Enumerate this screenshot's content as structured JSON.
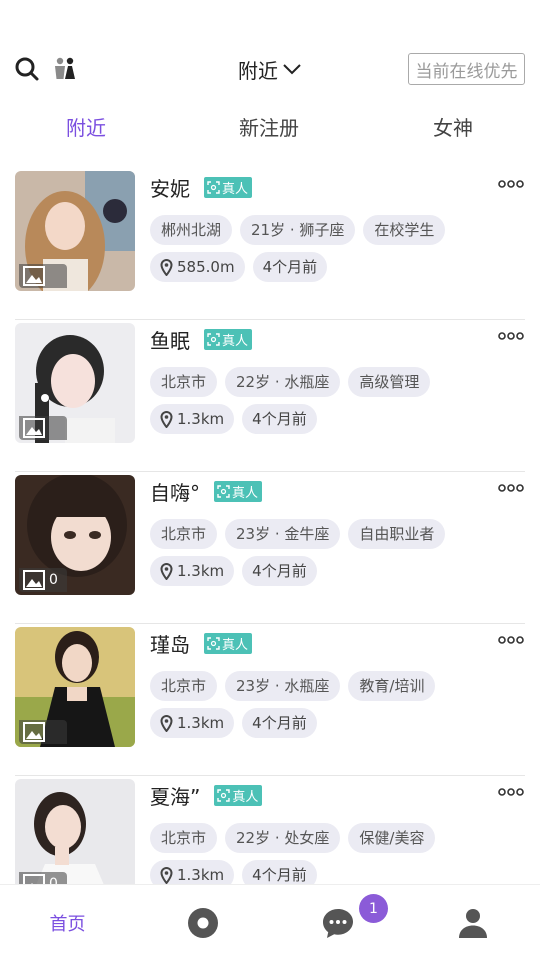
{
  "header": {
    "location_label": "附近",
    "online_button": "当前在线优先"
  },
  "tabs": [
    {
      "label": "附近",
      "active": true
    },
    {
      "label": "新注册",
      "active": false
    },
    {
      "label": "女神",
      "active": false
    }
  ],
  "verified_label": "真人",
  "users": [
    {
      "name": "安妮",
      "city": "郴州北湖",
      "age_sign": "21岁 · 狮子座",
      "occupation": "在校学生",
      "distance": "585.0m",
      "last_active": "4个月前",
      "photo_count": ""
    },
    {
      "name": "鱼眠",
      "city": "北京市",
      "age_sign": "22岁 · 水瓶座",
      "occupation": "高级管理",
      "distance": "1.3km",
      "last_active": "4个月前",
      "photo_count": ""
    },
    {
      "name": "自嗨°",
      "city": "北京市",
      "age_sign": "23岁 · 金牛座",
      "occupation": "自由职业者",
      "distance": "1.3km",
      "last_active": "4个月前",
      "photo_count": "0"
    },
    {
      "name": "瑾岛",
      "city": "北京市",
      "age_sign": "23岁 · 水瓶座",
      "occupation": "教育/培训",
      "distance": "1.3km",
      "last_active": "4个月前",
      "photo_count": ""
    },
    {
      "name": "夏海”",
      "city": "北京市",
      "age_sign": "22岁 · 处女座",
      "occupation": "保健/美容",
      "distance": "1.3km",
      "last_active": "4个月前",
      "photo_count": "0"
    }
  ],
  "tabbar": {
    "home_label": "首页",
    "message_badge": "1"
  },
  "colors": {
    "accent": "#7b4fe0",
    "verified": "#4cc1b6",
    "tag_bg": "#ebebf3",
    "badge": "#8b5bd8"
  },
  "icons": [
    "search-icon",
    "gender-icon",
    "chevron-down-icon",
    "more-icon",
    "photo-icon",
    "location-pin-icon",
    "face-scan-icon",
    "discover-icon",
    "chat-icon",
    "user-icon"
  ]
}
